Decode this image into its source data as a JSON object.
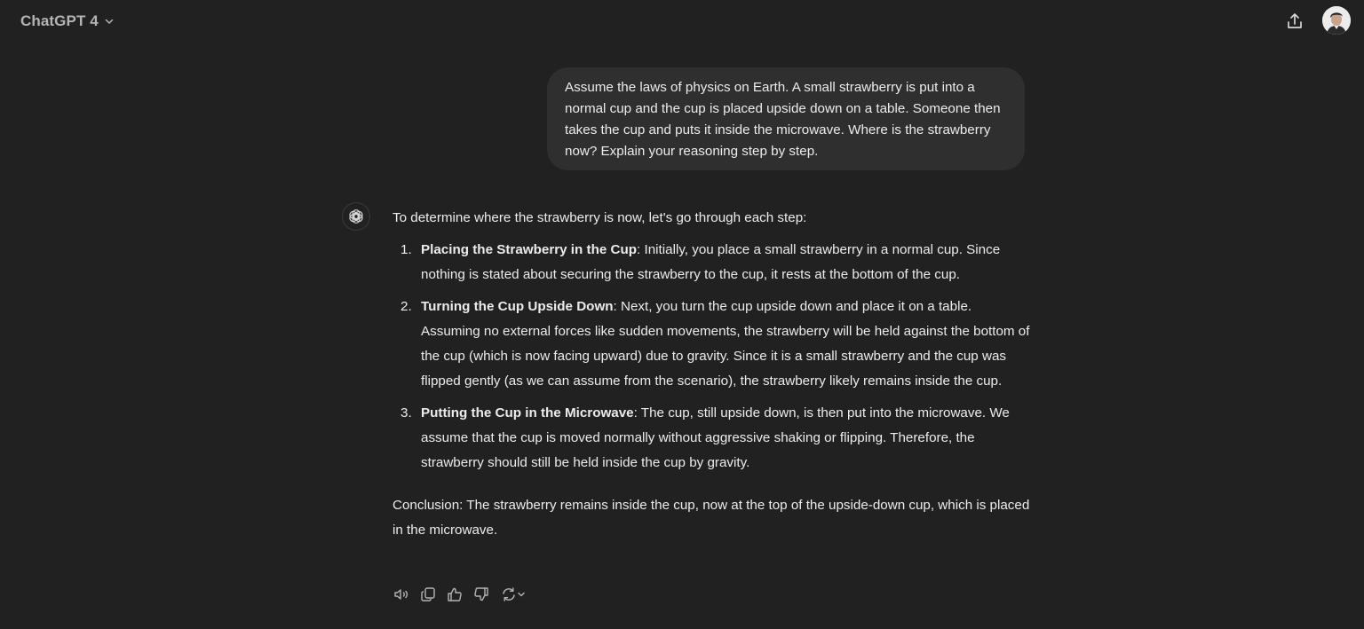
{
  "header": {
    "model_name": "ChatGPT 4",
    "model_chevron_icon": "chevron-down-icon",
    "share_icon": "share-upload-icon",
    "avatar_icon": "user-avatar"
  },
  "user_message": {
    "text": "Assume the laws of physics on Earth. A small strawberry is put into a normal cup and the cup is placed upside down on a table. Someone then takes the cup and puts it inside the microwave. Where is the strawberry now? Explain your reasoning step by step."
  },
  "assistant": {
    "icon": "openai-logo-icon",
    "intro": "To determine where the strawberry is now, let's go through each step:",
    "steps": [
      {
        "number": "1.",
        "title": "Placing the Strawberry in the Cup",
        "text": ": Initially, you place a small strawberry in a normal cup. Since nothing is stated about securing the strawberry to the cup, it rests at the bottom of the cup."
      },
      {
        "number": "2.",
        "title": "Turning the Cup Upside Down",
        "text": ": Next, you turn the cup upside down and place it on a table. Assuming no external forces like sudden movements, the strawberry will be held against the bottom of the cup (which is now facing upward) due to gravity. Since it is a small strawberry and the cup was flipped gently (as we can assume from the scenario), the strawberry likely remains inside the cup."
      },
      {
        "number": "3.",
        "title": "Putting the Cup in the Microwave",
        "text": ": The cup, still upside down, is then put into the microwave. We assume that the cup is moved normally without aggressive shaking or flipping. Therefore, the strawberry should still be held inside the cup by gravity."
      }
    ],
    "conclusion": "Conclusion: The strawberry remains inside the cup, now at the top of the upside-down cup, which is placed in the microwave."
  },
  "actions": [
    {
      "icon": "speaker-read-aloud-icon"
    },
    {
      "icon": "copy-icon"
    },
    {
      "icon": "thumbs-up-icon"
    },
    {
      "icon": "thumbs-down-icon"
    },
    {
      "icon": "regenerate-icon"
    }
  ],
  "colors": {
    "background": "#212121",
    "user_bubble": "#2f2f2f",
    "text": "#ececec",
    "muted": "#b4b4b4"
  }
}
